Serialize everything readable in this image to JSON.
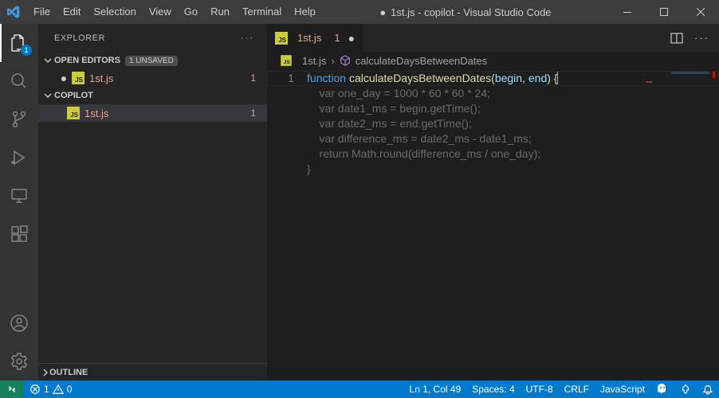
{
  "titlebar": {
    "menu": [
      "File",
      "Edit",
      "Selection",
      "View",
      "Go",
      "Run",
      "Terminal",
      "Help"
    ],
    "title_prefix": "●",
    "title": "1st.js - copilot - Visual Studio Code"
  },
  "activitybar": {
    "explorer_badge": "1"
  },
  "sidebar": {
    "title": "EXPLORER",
    "sections": {
      "open_editors": {
        "label": "OPEN EDITORS",
        "unsaved": "1 UNSAVED"
      },
      "folder": {
        "label": "COPILOT"
      },
      "outline": {
        "label": "OUTLINE"
      }
    },
    "files": {
      "open_editor_item": {
        "name": "1st.js",
        "problems": "1"
      },
      "folder_item": {
        "name": "1st.js",
        "problems": "1"
      }
    },
    "js_icon_text": "JS"
  },
  "tabs": {
    "active": {
      "name": "1st.js",
      "problems": "1"
    }
  },
  "breadcrumb": {
    "file": "1st.js",
    "symbol": "calculateDaysBetweenDates"
  },
  "editor": {
    "line_number": "1",
    "line1": {
      "kw": "function",
      "fn": "calculateDaysBetweenDates",
      "p_open": "(",
      "param1": "begin",
      "comma": ", ",
      "param2": "end",
      "p_close": ") ",
      "brace": "{"
    },
    "ghost_lines": [
      "    var one_day = 1000 * 60 * 60 * 24;",
      "    var date1_ms = begin.getTime();",
      "    var date2_ms = end.getTime();",
      "    var difference_ms = date2_ms - date1_ms;",
      "    return Math.round(difference_ms / one_day);",
      "}"
    ]
  },
  "statusbar": {
    "errors": "1",
    "warnings": "0",
    "cursor": "Ln 1, Col 49",
    "spaces": "Spaces: 4",
    "encoding": "UTF-8",
    "eol": "CRLF",
    "language": "JavaScript"
  }
}
